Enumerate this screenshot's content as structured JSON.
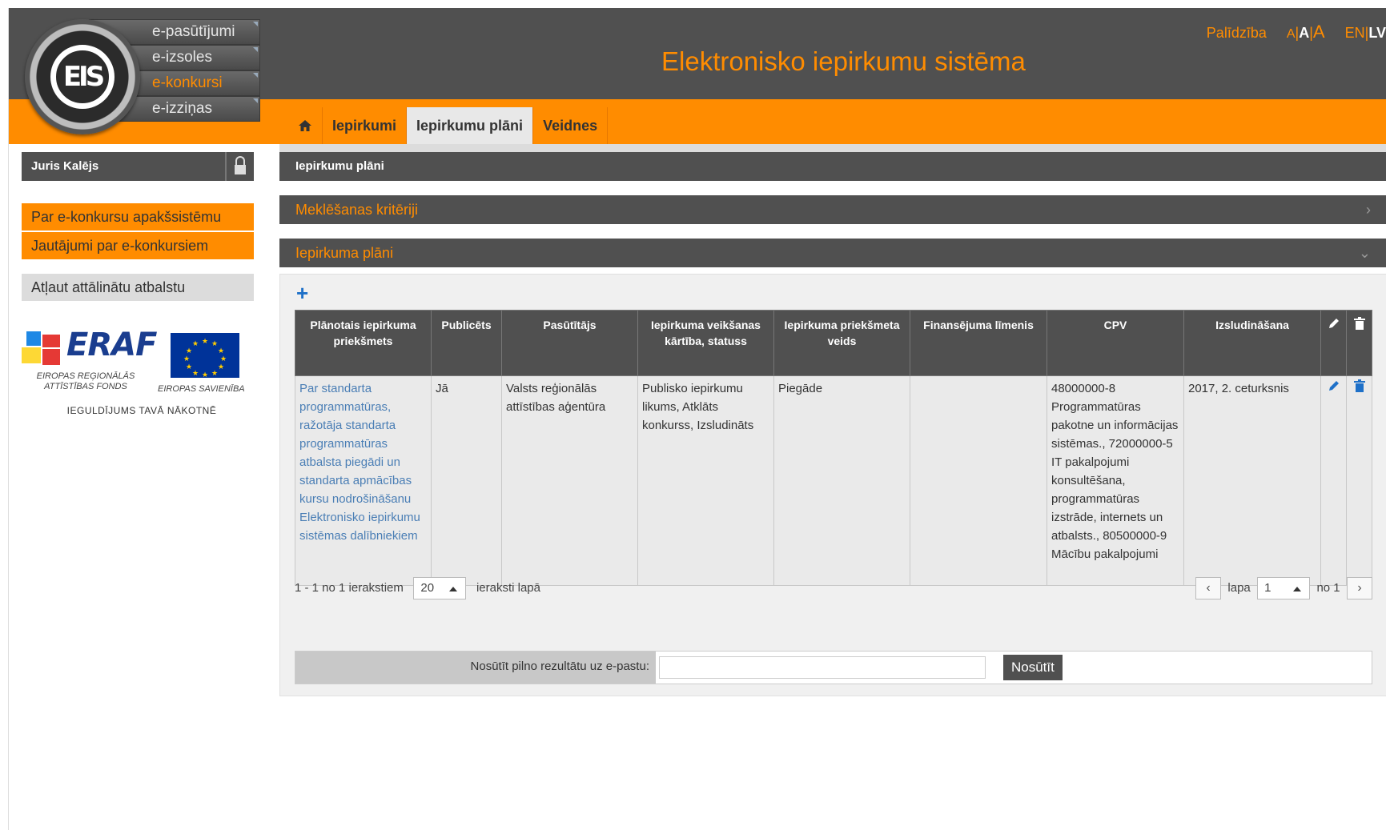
{
  "header": {
    "subsystems": [
      {
        "label": "e-pasūtījumi",
        "active": false
      },
      {
        "label": "e-izsoles",
        "active": false
      },
      {
        "label": "e-konkursi",
        "active": true
      },
      {
        "label": "e-izziņas",
        "active": false
      }
    ],
    "system_title": "Elektronisko iepirkumu sistēma",
    "help_link": "Palīdzība",
    "font_sizes": [
      "A",
      "|",
      "A",
      "|",
      "A"
    ],
    "languages": [
      "EN",
      "|",
      "LV"
    ]
  },
  "tabs": [
    {
      "label": "Iepirkumi",
      "active": false
    },
    {
      "label": "Iepirkumu plāni",
      "active": true
    },
    {
      "label": "Veidnes",
      "active": false
    }
  ],
  "sidebar": {
    "user_name": "Juris Kalējs",
    "links": [
      {
        "label": "Par e-konkursu apakšsistēmu"
      },
      {
        "label": "Jautājumi par e-konkursiem"
      }
    ],
    "grey_link": "Atļaut attālinātu atbalstu",
    "eraf": {
      "logo_text": "ERAF",
      "fund_text_1": "EIROPAS REĢIONĀLĀS",
      "fund_text_2": "ATTĪSTĪBAS FONDS",
      "eu_text": "EIROPAS SAVIENĪBA",
      "invest_text": "IEGULDĪJUMS TAVĀ NĀKOTNĒ"
    }
  },
  "main": {
    "page_title": "Iepirkumu plāni",
    "search_section": "Meklēšanas kritēriji",
    "results_section": "Iepirkuma plāni",
    "table": {
      "columns": [
        "Plānotais iepirkuma priekšmets",
        "Publicēts",
        "Pasūtītājs",
        "Iepirkuma veikšanas kārtība, statuss",
        "Iepirkuma priekšmeta veids",
        "Finansējuma līmenis",
        "CPV",
        "Izsludināšana"
      ],
      "rows": [
        {
          "subject": "Par standarta programmatūras, ražotāja standarta programmatūras atbalsta piegādi un standarta apmācības kursu nodrošināšanu Elektronisko iepirkumu sistēmas dalībniekiem",
          "published": "Jā",
          "customer": "Valsts reģionālās attīstības aģentūra",
          "procedure": "Publisko iepirkumu likums, Atklāts konkurss, Izsludināts",
          "type": "Piegāde",
          "funding": "",
          "cpv": "48000000-8 Programmatūras pakotne un informācijas sistēmas., 72000000-5 IT pakalpojumi konsultēšana, programmatūras izstrāde, internets un atbalsts., 80500000-9 Mācību pakalpojumi",
          "announcement": "2017, 2. ceturksnis"
        }
      ]
    },
    "pager": {
      "range_text": "1 - 1 no 1 ierakstiem",
      "page_size": "20",
      "per_page_text": "ieraksti lapā",
      "page_label": "lapa",
      "page_value": "1",
      "of_text": "no 1"
    },
    "email": {
      "label": "Nosūtīt pilno rezultātu uz e-pastu:",
      "value": "",
      "button": "Nosūtīt"
    }
  },
  "colors": {
    "accent": "#ff8c00",
    "dark": "#505050",
    "link": "#4a7eb5",
    "action_icon": "#1e70c8"
  },
  "icons": [
    "home-icon",
    "lock-icon",
    "plus-icon",
    "pencil-icon",
    "trash-icon",
    "chevron-right-icon",
    "chevron-down-icon",
    "chevron-left-icon"
  ]
}
